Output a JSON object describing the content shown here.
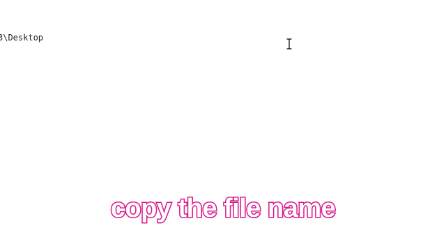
{
  "terminal": {
    "path_line": "3\\Desktop"
  },
  "cursor": {
    "icon": "ibeam-cursor-icon"
  },
  "overlay": {
    "caption": "copy the file name",
    "caption_fill_color": "#ffffff",
    "caption_outline_color": "#e0188f"
  }
}
